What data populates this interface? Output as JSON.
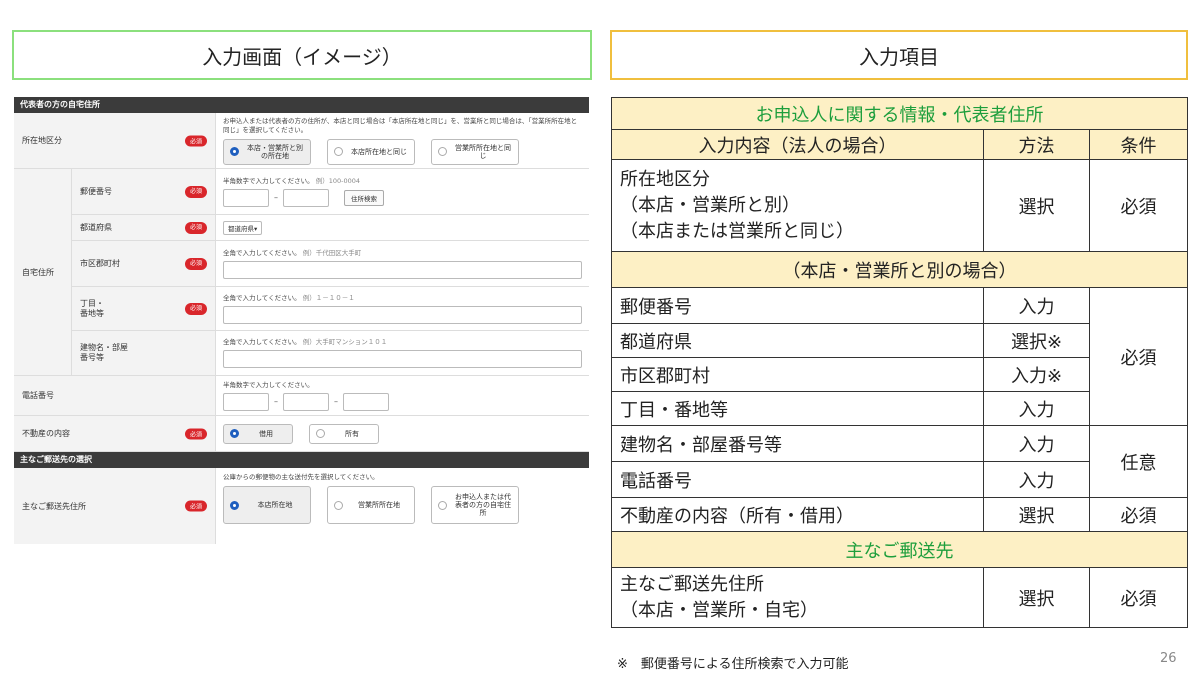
{
  "headers": {
    "left": "入力画面（イメージ）",
    "right": "入力項目"
  },
  "form": {
    "section1": "代表者の方の自宅住所",
    "required": "必須",
    "location": {
      "label": "所在地区分",
      "note": "お申込人または代表者の方の住所が、本店と同じ場合は「本店所在地と同じ」を、営業所と同じ場合は、「営業所所在地と同じ」を選択してください。",
      "options": [
        "本店・営業所と別の所在地",
        "本店所在地と同じ",
        "営業所所在地と同じ"
      ]
    },
    "home": {
      "label": "自宅住所",
      "postal": {
        "label": "郵便番号",
        "note": "半角数字で入力してください。",
        "example": "例）100-0004",
        "button": "住所検索"
      },
      "pref": {
        "label": "都道府県",
        "select": "都道府県▾"
      },
      "city": {
        "label": "市区郡町村",
        "note": "全角で入力してください。",
        "example": "例）千代田区大手町"
      },
      "block": {
        "label": "丁目・番地等",
        "note": "全角で入力してください。",
        "example": "例）１－１０－１"
      },
      "bldg": {
        "label": "建物名・部屋番号等",
        "note": "全角で入力してください。",
        "example": "例）大手町マンション１０１"
      }
    },
    "phone": {
      "label": "電話番号",
      "note": "半角数字で入力してください。"
    },
    "property": {
      "label": "不動産の内容",
      "options": [
        "借用",
        "所有"
      ]
    },
    "section2": "主なご郵送先の選択",
    "mail": {
      "label": "主なご郵送先住所",
      "note": "公庫からの郵便物の主な送付先を選択してください。",
      "options": [
        "本店所在地",
        "営業所所在地",
        "お申込人または代表者の方の自宅住所"
      ]
    }
  },
  "table": {
    "title1": "お申込人に関する情報・代表者住所",
    "col_item": "入力内容（法人の場合）",
    "col_method": "方法",
    "col_cond": "条件",
    "row_loc": {
      "l1": "所在地区分",
      "l2": "（本店・営業所と別）",
      "l3": "（本店または営業所と同じ）",
      "method": "選択",
      "cond": "必須"
    },
    "sub_band": "（本店・営業所と別の場合）",
    "postal": {
      "item": "郵便番号",
      "method": "入力"
    },
    "pref": {
      "item": "都道府県",
      "method": "選択※"
    },
    "city": {
      "item": "市区郡町村",
      "method": "入力※"
    },
    "block": {
      "item": "丁目・番地等",
      "method": "入力"
    },
    "addr_cond": "必須",
    "bldg": {
      "item": "建物名・部屋番号等",
      "method": "入力"
    },
    "phone": {
      "item": "電話番号",
      "method": "入力"
    },
    "opt_cond": "任意",
    "property": {
      "item": "不動産の内容（所有・借用）",
      "method": "選択",
      "cond": "必須"
    },
    "title2": "主なご郵送先",
    "mail": {
      "l1": "主なご郵送先住所",
      "l2": "（本店・営業所・自宅）",
      "method": "選択",
      "cond": "必須"
    }
  },
  "footnote": "※　郵便番号による住所検索で入力可能",
  "page_number": "26",
  "colors": {
    "left_header_border": "#8be07d",
    "right_header_border": "#f0bf3e",
    "band": "#fdf0c5",
    "green_text": "#1d9e3c",
    "required_badge": "#d9262b"
  }
}
